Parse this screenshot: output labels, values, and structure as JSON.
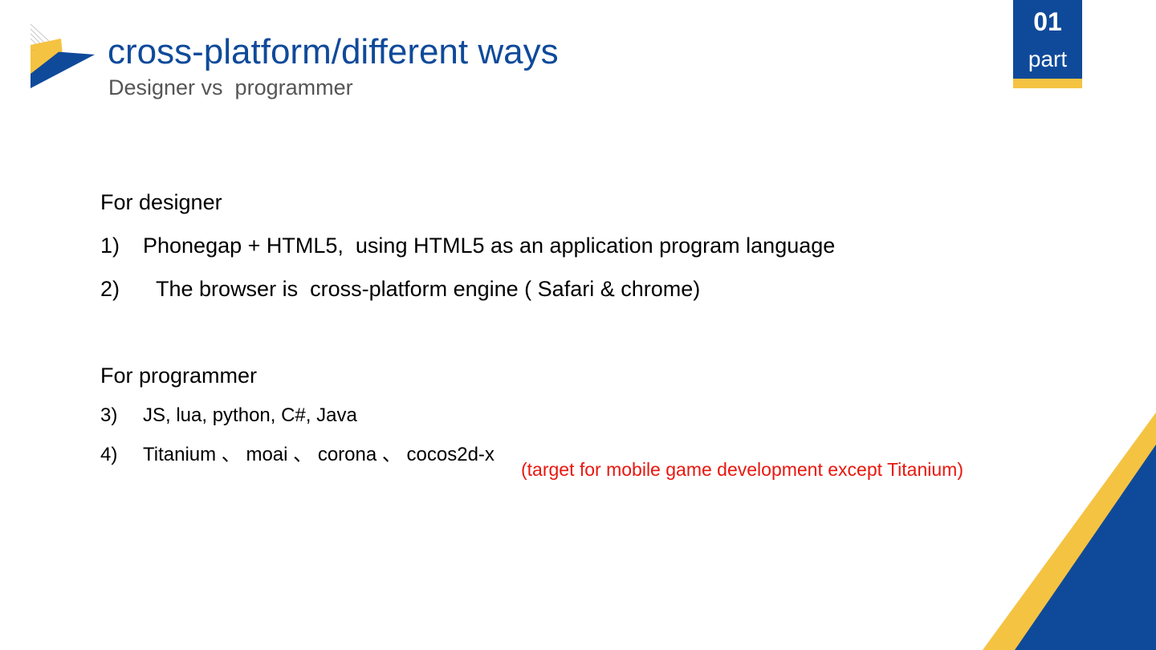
{
  "header": {
    "title": "cross-platform/different ways",
    "subtitle": "Designer vs  programmer"
  },
  "part_badge": {
    "number": "01",
    "label": "part"
  },
  "designer_section": {
    "heading": "For designer",
    "items": [
      {
        "number": "1)",
        "text": "Phonegap + HTML5,  using HTML5 as an application program language"
      },
      {
        "number": "2)",
        "text": " The browser is  cross-platform engine ( Safari & chrome)"
      }
    ]
  },
  "programmer_section": {
    "heading": "For programmer ὜",
    "items": [
      {
        "number": "3)",
        "text": "JS, lua, python, C#, Java"
      },
      {
        "number": "4)",
        "text": "Titanium 、 moai 、 corona 、 cocos2d-x"
      }
    ],
    "note": "(target for mobile game development except Titanium)"
  },
  "colors": {
    "accent_blue": "#0f4a9a",
    "accent_yellow": "#f5c342",
    "note_red": "#e8170f"
  },
  "icons": {
    "logo": "triangle-logo-icon",
    "corner": "corner-triangles-decoration"
  }
}
